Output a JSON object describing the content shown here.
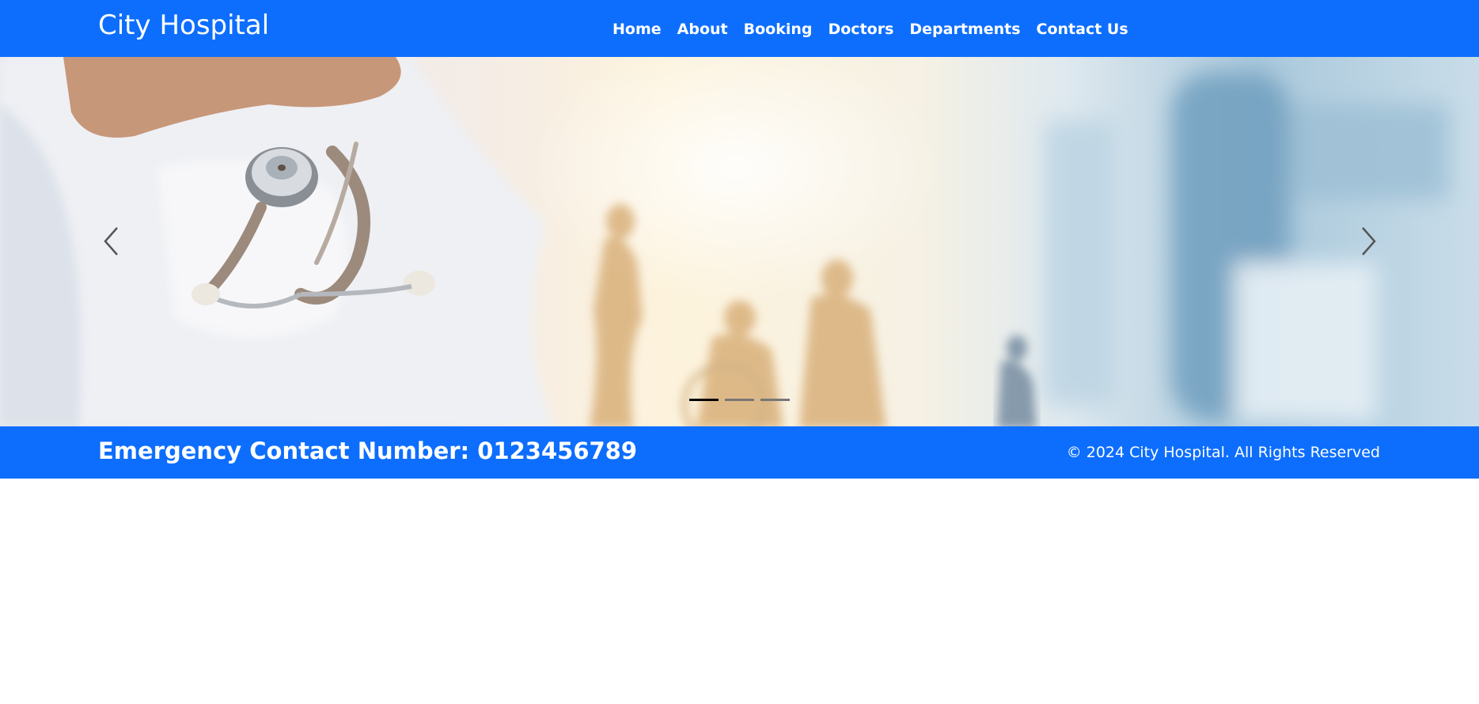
{
  "header": {
    "brand": "City Hospital",
    "nav": [
      "Home",
      "About",
      "Booking",
      "Doctors",
      "Departments",
      "Contact Us"
    ]
  },
  "carousel": {
    "slide_count": 3,
    "active_index": 0,
    "icons": {
      "prev": "chevron-left-icon",
      "next": "chevron-right-icon"
    }
  },
  "footer": {
    "emergency": "Emergency Contact Number: 0123456789",
    "copyright": "© 2024 City Hospital. All Rights Reserved"
  },
  "colors": {
    "primary": "#0d6efd",
    "indicator_active": "#000000",
    "indicator_inactive": "#777777"
  }
}
